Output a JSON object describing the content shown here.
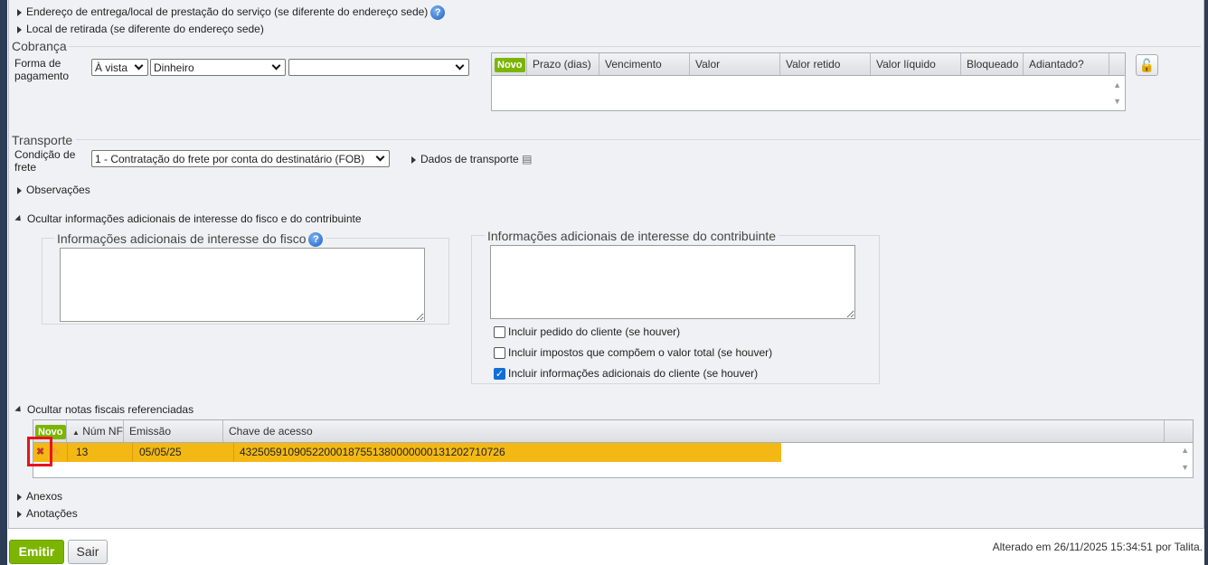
{
  "sections": {
    "entrega": "Endereço de entrega/local de prestação do serviço (se diferente do endereço sede)",
    "retirada": "Local de retirada (se diferente do endereço sede)",
    "observacoes": "Observações",
    "ocultar_info": "Ocultar informações adicionais de interesse do fisco e do contribuinte",
    "ocultar_notas": "Ocultar notas fiscais referenciadas",
    "anexos": "Anexos",
    "anotacoes": "Anotações"
  },
  "cobranca": {
    "legend": "Cobrança",
    "forma_label": "Forma de pagamento",
    "condicao": "À vista",
    "meio": "Dinheiro",
    "extra": "",
    "grid": {
      "novo": "Novo",
      "columns": [
        "Prazo (dias)",
        "Vencimento",
        "Valor",
        "Valor retido",
        "Valor líquido",
        "Bloqueado",
        "Adiantado?"
      ],
      "rows": []
    },
    "lock_icon": "unlock-icon"
  },
  "transporte": {
    "legend": "Transporte",
    "condicao_label": "Condição de frete",
    "condicao_value": "1 - Contratação do frete por conta do destinatário (FOB)",
    "dados_link": "Dados de transporte"
  },
  "info": {
    "fisco_legend": "Informações adicionais de interesse do fisco",
    "fisco_value": "",
    "contrib_legend": "Informações adicionais de interesse do contribuinte",
    "contrib_value": "",
    "checkboxes": [
      {
        "label": "Incluir pedido do cliente (se houver)",
        "checked": false
      },
      {
        "label": "Incluir impostos que compõem o valor total (se houver)",
        "checked": false
      },
      {
        "label": "Incluir informações adicionais do cliente (se houver)",
        "checked": true
      }
    ]
  },
  "notas": {
    "novo": "Novo",
    "columns": [
      "Núm NF",
      "Emissão",
      "Chave de acesso"
    ],
    "rows": [
      {
        "num": "13",
        "emissao": "05/05/25",
        "chave": "43250591090522000187551380000000131202710726"
      }
    ],
    "selected_color": "#f3b814"
  },
  "footer": {
    "emitir": "Emitir",
    "sair": "Sair",
    "status": "Alterado em 26/11/2025 15:34:51 por Talita."
  }
}
